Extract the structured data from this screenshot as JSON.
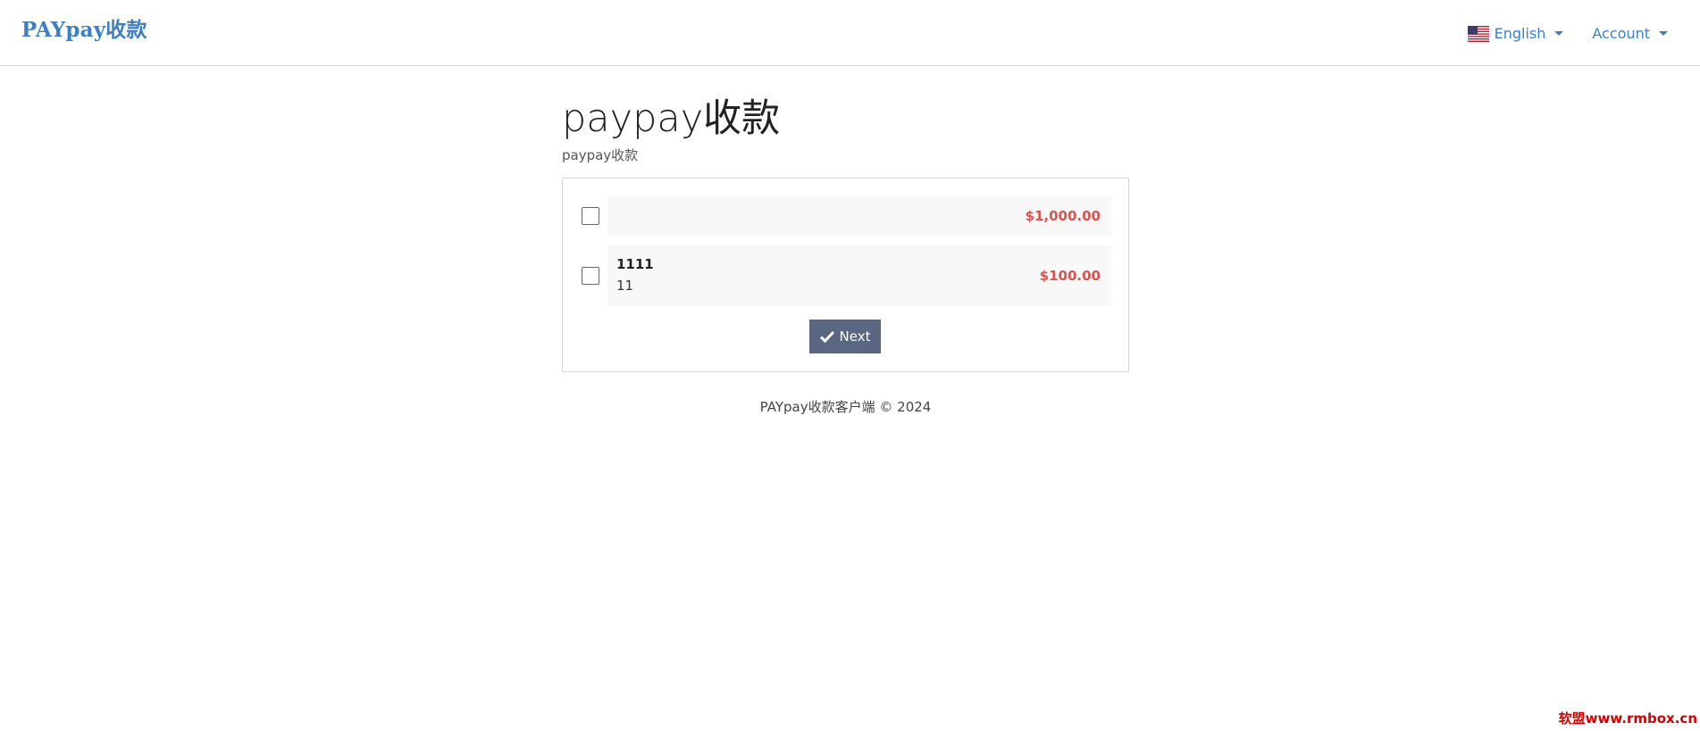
{
  "navbar": {
    "brand": "PAYpay收款",
    "language": {
      "label": "English",
      "icon": "us-flag-icon"
    },
    "account": {
      "label": "Account"
    }
  },
  "page": {
    "title": "paypay收款",
    "subtitle": "paypay收款"
  },
  "options": [
    {
      "name": "",
      "description": "",
      "amount": "$1,000.00",
      "checked": false
    },
    {
      "name": "1111",
      "description": "11",
      "amount": "$100.00",
      "checked": false
    }
  ],
  "next_button": {
    "label": "Next",
    "icon": "check-icon"
  },
  "footer": {
    "text": "PAYpay收款客户端 © 2024"
  },
  "watermark": "软盟www.rmbox.cn",
  "colors": {
    "brand": "#3d7fc5",
    "amount": "#d9534f",
    "button": "#5a6782"
  }
}
